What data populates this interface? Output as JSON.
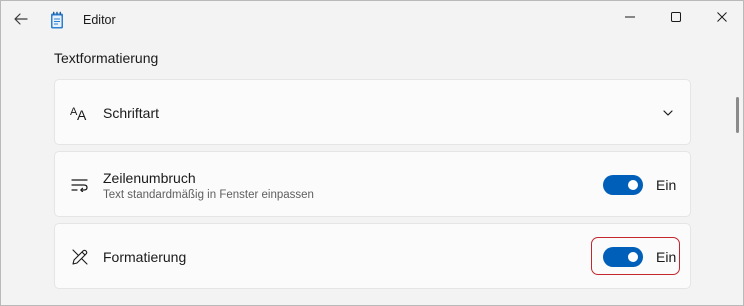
{
  "window": {
    "title": "Editor",
    "controls": {
      "minimize": "minimize-icon",
      "maximize": "maximize-icon",
      "close": "close-icon"
    }
  },
  "section": {
    "title": "Textformatierung"
  },
  "settings": [
    {
      "icon": "font-icon",
      "label": "Schriftart",
      "control": "chevron-down-icon"
    },
    {
      "icon": "word-wrap-icon",
      "label": "Zeilenumbruch",
      "description": "Text standardmäßig in Fenster einpassen",
      "toggle": {
        "state": true,
        "label": "Ein"
      }
    },
    {
      "icon": "formatting-pen-icon",
      "label": "Formatierung",
      "toggle": {
        "state": true,
        "label": "Ein"
      }
    }
  ],
  "colors": {
    "accent": "#005fb8",
    "highlight": "#c4262e"
  }
}
